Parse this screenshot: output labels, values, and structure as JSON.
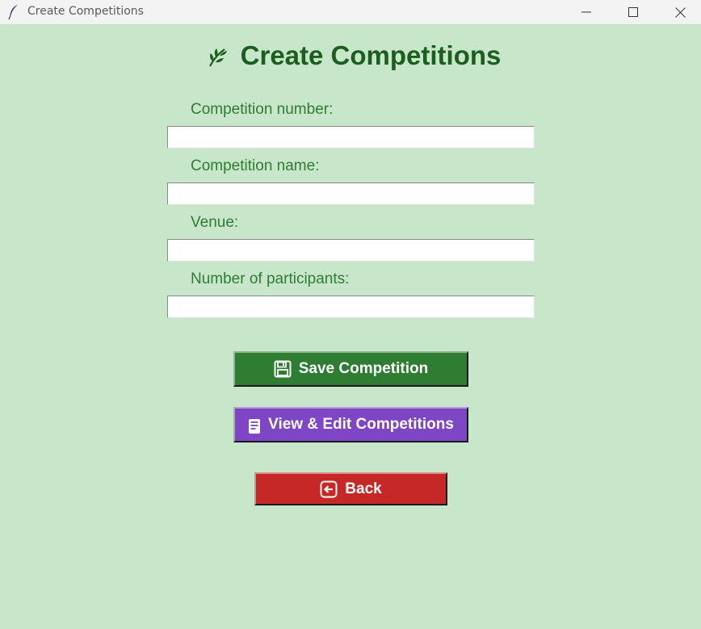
{
  "window": {
    "title": "Create Competitions",
    "controls": {
      "minimize": "minimize-icon",
      "maximize": "maximize-icon",
      "close": "close-icon"
    }
  },
  "header": {
    "icon": "leaf-icon",
    "title": "Create Competitions"
  },
  "form": {
    "fields": [
      {
        "label": "Competition number:",
        "value": ""
      },
      {
        "label": "Competition name:",
        "value": ""
      },
      {
        "label": "Venue:",
        "value": ""
      },
      {
        "label": "Number of participants:",
        "value": ""
      }
    ]
  },
  "buttons": {
    "save": {
      "label": "Save Competition",
      "icon": "floppy-disk-icon"
    },
    "view_edit": {
      "label": "View & Edit Competitions",
      "icon": "document-icon"
    },
    "back": {
      "label": "Back",
      "icon": "back-arrow-icon"
    }
  },
  "colors": {
    "background": "#c8e6c9",
    "heading": "#1b5e20",
    "label": "#2e7d32",
    "save_button": "#2e7d32",
    "view_button": "#7e45c4",
    "back_button": "#c62828"
  }
}
